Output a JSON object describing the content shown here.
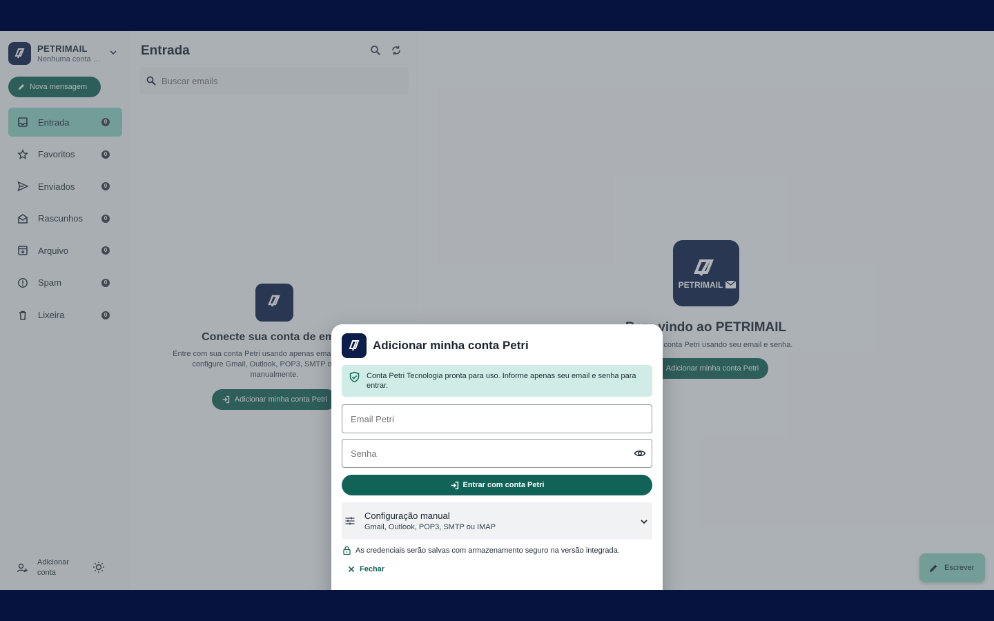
{
  "sidebar": {
    "brand_name": "PETRIMAIL",
    "brand_sub": "Nenhuma conta conectada",
    "compose_label": "Nova mensagem",
    "items": [
      {
        "label": "Entrada",
        "count": "0"
      },
      {
        "label": "Favoritos",
        "count": "0"
      },
      {
        "label": "Enviados",
        "count": "0"
      },
      {
        "label": "Rascunhos",
        "count": "0"
      },
      {
        "label": "Arquivo",
        "count": "0"
      },
      {
        "label": "Spam",
        "count": "0"
      },
      {
        "label": "Lixeira",
        "count": "0"
      }
    ],
    "add_account_label": "Adicionar conta"
  },
  "list": {
    "title": "Entrada",
    "search_placeholder": "Buscar emails",
    "empty_title": "Conecte sua conta de email",
    "empty_text": "Entre com sua conta Petri usando apenas email e senha, ou configure Gmail, Outlook, POP3, SMTP ou IMAP manualmente.",
    "empty_button": "Adicionar minha conta Petri"
  },
  "pane": {
    "logo_text": "PETRIMAIL",
    "welcome_title": "Bem-vindo ao PETRIMAIL",
    "welcome_text": "Conecte sua conta Petri usando seu email e senha.",
    "welcome_button": "Adicionar minha conta Petri",
    "write_label": "Escrever"
  },
  "dialog": {
    "title": "Adicionar minha conta Petri",
    "info": "Conta Petri Tecnologia pronta para uso. Informe apenas seu email e senha para entrar.",
    "email_placeholder": "Email Petri",
    "password_placeholder": "Senha",
    "submit_label": "Entrar com conta Petri",
    "manual_title": "Configuração manual",
    "manual_sub": "Gmail, Outlook, POP3, SMTP ou IMAP",
    "secure_text": "As credenciais serão salvas com armazenamento seguro na versão integrada.",
    "close_label": "Fechar"
  },
  "colors": {
    "accent": "#126357",
    "active_bg": "#8fd6c8",
    "logo_bg": "#0c1d4a",
    "frame": "#06133f"
  }
}
